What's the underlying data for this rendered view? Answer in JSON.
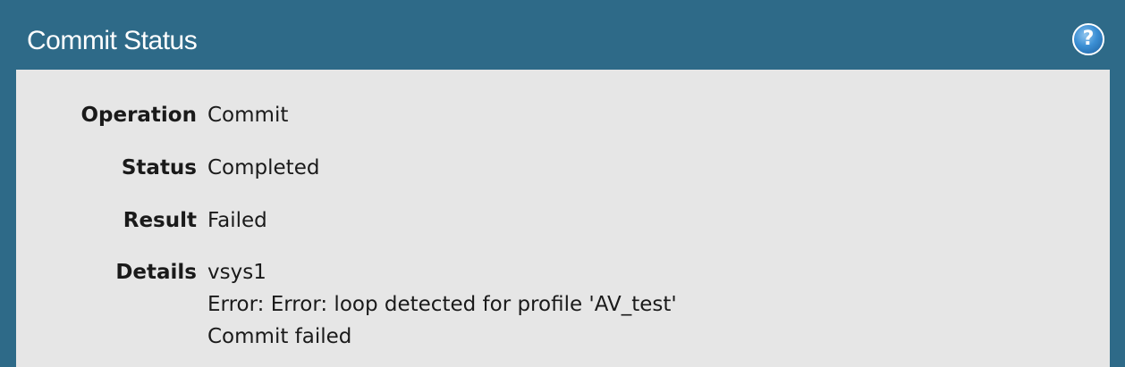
{
  "dialog": {
    "title": "Commit Status",
    "help_icon": "help-icon",
    "help_glyph": "?"
  },
  "fields": {
    "operation": {
      "label": "Operation",
      "value": "Commit"
    },
    "status": {
      "label": "Status",
      "value": "Completed"
    },
    "result": {
      "label": "Result",
      "value": "Failed"
    },
    "details": {
      "label": "Details",
      "lines": [
        "vsys1",
        "Error: Error: loop detected for profile 'AV_test'",
        "Commit failed"
      ]
    }
  },
  "colors": {
    "titlebar": "#2e6a88",
    "content_bg": "#e6e6e6",
    "text": "#1a1a1a",
    "help_icon": "#3b8fd4"
  }
}
